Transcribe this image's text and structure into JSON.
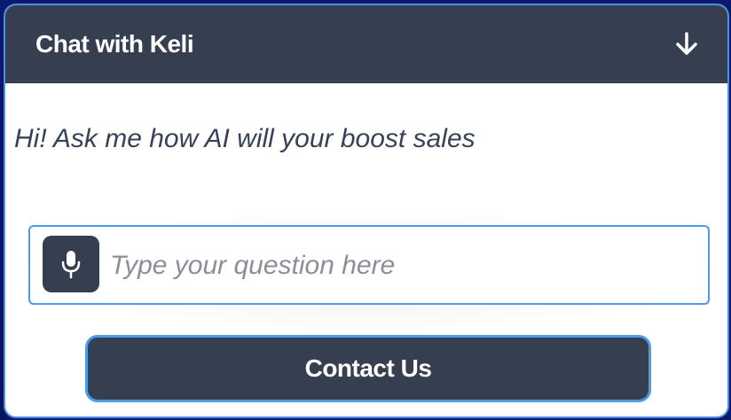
{
  "chat": {
    "title": "Chat with Keli",
    "greeting": "Hi! Ask me how AI will your boost sales",
    "input_placeholder": "Type your question here",
    "contact_label": "Contact Us",
    "collapse_icon": "arrow-down-icon",
    "mic_icon": "microphone-icon"
  },
  "colors": {
    "header": "#363f50",
    "accent_border": "#4d9ae6",
    "greeting_text": "#384257",
    "page_background": "#0b1a6b"
  }
}
